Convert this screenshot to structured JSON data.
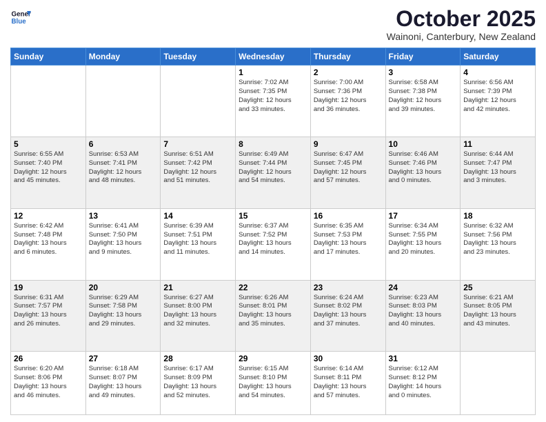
{
  "logo": {
    "line1": "General",
    "line2": "Blue"
  },
  "title": "October 2025",
  "location": "Wainoni, Canterbury, New Zealand",
  "days_header": [
    "Sunday",
    "Monday",
    "Tuesday",
    "Wednesday",
    "Thursday",
    "Friday",
    "Saturday"
  ],
  "weeks": [
    [
      {
        "day": "",
        "info": ""
      },
      {
        "day": "",
        "info": ""
      },
      {
        "day": "",
        "info": ""
      },
      {
        "day": "1",
        "info": "Sunrise: 7:02 AM\nSunset: 7:35 PM\nDaylight: 12 hours\nand 33 minutes."
      },
      {
        "day": "2",
        "info": "Sunrise: 7:00 AM\nSunset: 7:36 PM\nDaylight: 12 hours\nand 36 minutes."
      },
      {
        "day": "3",
        "info": "Sunrise: 6:58 AM\nSunset: 7:38 PM\nDaylight: 12 hours\nand 39 minutes."
      },
      {
        "day": "4",
        "info": "Sunrise: 6:56 AM\nSunset: 7:39 PM\nDaylight: 12 hours\nand 42 minutes."
      }
    ],
    [
      {
        "day": "5",
        "info": "Sunrise: 6:55 AM\nSunset: 7:40 PM\nDaylight: 12 hours\nand 45 minutes."
      },
      {
        "day": "6",
        "info": "Sunrise: 6:53 AM\nSunset: 7:41 PM\nDaylight: 12 hours\nand 48 minutes."
      },
      {
        "day": "7",
        "info": "Sunrise: 6:51 AM\nSunset: 7:42 PM\nDaylight: 12 hours\nand 51 minutes."
      },
      {
        "day": "8",
        "info": "Sunrise: 6:49 AM\nSunset: 7:44 PM\nDaylight: 12 hours\nand 54 minutes."
      },
      {
        "day": "9",
        "info": "Sunrise: 6:47 AM\nSunset: 7:45 PM\nDaylight: 12 hours\nand 57 minutes."
      },
      {
        "day": "10",
        "info": "Sunrise: 6:46 AM\nSunset: 7:46 PM\nDaylight: 13 hours\nand 0 minutes."
      },
      {
        "day": "11",
        "info": "Sunrise: 6:44 AM\nSunset: 7:47 PM\nDaylight: 13 hours\nand 3 minutes."
      }
    ],
    [
      {
        "day": "12",
        "info": "Sunrise: 6:42 AM\nSunset: 7:48 PM\nDaylight: 13 hours\nand 6 minutes."
      },
      {
        "day": "13",
        "info": "Sunrise: 6:41 AM\nSunset: 7:50 PM\nDaylight: 13 hours\nand 9 minutes."
      },
      {
        "day": "14",
        "info": "Sunrise: 6:39 AM\nSunset: 7:51 PM\nDaylight: 13 hours\nand 11 minutes."
      },
      {
        "day": "15",
        "info": "Sunrise: 6:37 AM\nSunset: 7:52 PM\nDaylight: 13 hours\nand 14 minutes."
      },
      {
        "day": "16",
        "info": "Sunrise: 6:35 AM\nSunset: 7:53 PM\nDaylight: 13 hours\nand 17 minutes."
      },
      {
        "day": "17",
        "info": "Sunrise: 6:34 AM\nSunset: 7:55 PM\nDaylight: 13 hours\nand 20 minutes."
      },
      {
        "day": "18",
        "info": "Sunrise: 6:32 AM\nSunset: 7:56 PM\nDaylight: 13 hours\nand 23 minutes."
      }
    ],
    [
      {
        "day": "19",
        "info": "Sunrise: 6:31 AM\nSunset: 7:57 PM\nDaylight: 13 hours\nand 26 minutes."
      },
      {
        "day": "20",
        "info": "Sunrise: 6:29 AM\nSunset: 7:58 PM\nDaylight: 13 hours\nand 29 minutes."
      },
      {
        "day": "21",
        "info": "Sunrise: 6:27 AM\nSunset: 8:00 PM\nDaylight: 13 hours\nand 32 minutes."
      },
      {
        "day": "22",
        "info": "Sunrise: 6:26 AM\nSunset: 8:01 PM\nDaylight: 13 hours\nand 35 minutes."
      },
      {
        "day": "23",
        "info": "Sunrise: 6:24 AM\nSunset: 8:02 PM\nDaylight: 13 hours\nand 37 minutes."
      },
      {
        "day": "24",
        "info": "Sunrise: 6:23 AM\nSunset: 8:03 PM\nDaylight: 13 hours\nand 40 minutes."
      },
      {
        "day": "25",
        "info": "Sunrise: 6:21 AM\nSunset: 8:05 PM\nDaylight: 13 hours\nand 43 minutes."
      }
    ],
    [
      {
        "day": "26",
        "info": "Sunrise: 6:20 AM\nSunset: 8:06 PM\nDaylight: 13 hours\nand 46 minutes."
      },
      {
        "day": "27",
        "info": "Sunrise: 6:18 AM\nSunset: 8:07 PM\nDaylight: 13 hours\nand 49 minutes."
      },
      {
        "day": "28",
        "info": "Sunrise: 6:17 AM\nSunset: 8:09 PM\nDaylight: 13 hours\nand 52 minutes."
      },
      {
        "day": "29",
        "info": "Sunrise: 6:15 AM\nSunset: 8:10 PM\nDaylight: 13 hours\nand 54 minutes."
      },
      {
        "day": "30",
        "info": "Sunrise: 6:14 AM\nSunset: 8:11 PM\nDaylight: 13 hours\nand 57 minutes."
      },
      {
        "day": "31",
        "info": "Sunrise: 6:12 AM\nSunset: 8:12 PM\nDaylight: 14 hours\nand 0 minutes."
      },
      {
        "day": "",
        "info": ""
      }
    ]
  ]
}
